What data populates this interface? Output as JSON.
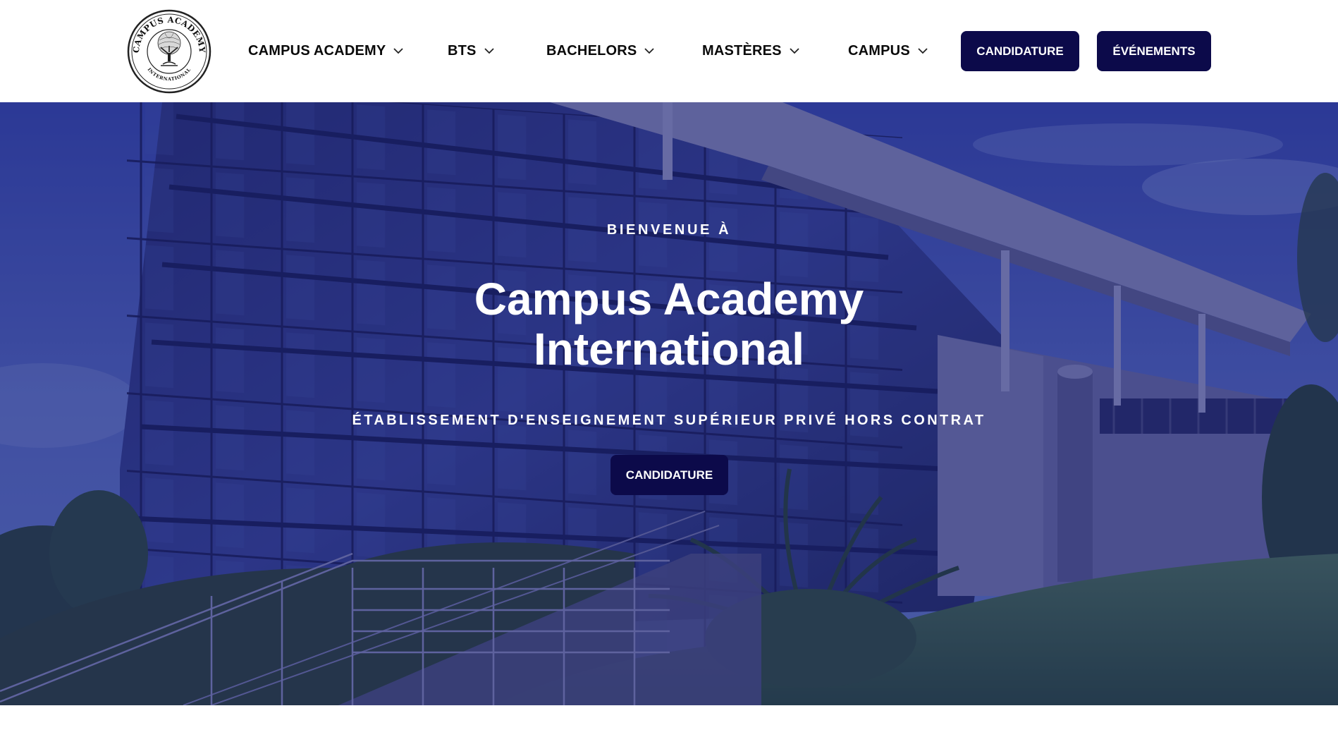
{
  "header": {
    "logo": {
      "arc_text_top": "CAMPUS ACADEMY",
      "arc_text_bottom": "INTERNATIONAL",
      "icon": "tree-icon"
    },
    "nav": [
      {
        "label": "CAMPUS ACADEMY",
        "icon": "chevron-down-icon"
      },
      {
        "label": "BTS",
        "icon": "chevron-down-icon"
      },
      {
        "label": "BACHELORS",
        "icon": "chevron-down-icon"
      },
      {
        "label": "MASTÈRES",
        "icon": "chevron-down-icon"
      },
      {
        "label": "CAMPUS",
        "icon": "chevron-down-icon"
      }
    ],
    "buttons": {
      "candidature": "CANDIDATURE",
      "evenements": "ÉVÉNEMENTS"
    }
  },
  "hero": {
    "eyebrow": "BIENVENUE À",
    "title_line1": "Campus Academy",
    "title_line2": "International",
    "tagline": "ÉTABLISSEMENT D'ENSEIGNEMENT SUPÉRIEUR PRIVÉ HORS CONTRAT",
    "cta": "CANDIDATURE"
  },
  "colors": {
    "brand_navy": "#0c0a4a",
    "hero_overlay": "#14166e",
    "text_dark": "#0a0a0a",
    "white": "#ffffff"
  }
}
